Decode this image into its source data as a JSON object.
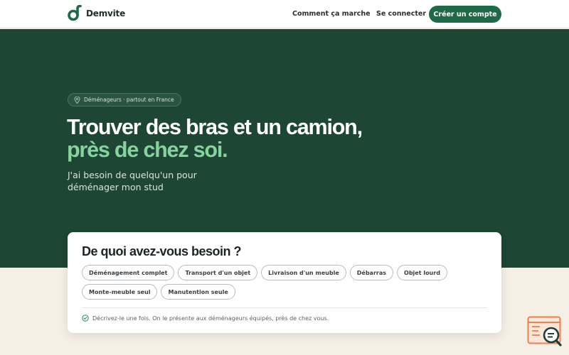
{
  "header": {
    "brand": "Demvite",
    "logo_icon": "demvite-logo-icon",
    "nav": {
      "how_it_works": "Comment ça marche",
      "login": "Se connecter",
      "signup": "Créer un compte"
    }
  },
  "hero": {
    "badge": {
      "icon": "map-pin-icon",
      "text": "Déménageurs · partout en France"
    },
    "title_line1": "Trouver des bras et un camion,",
    "title_line2": "près de chez soi.",
    "subtitle": "J'ai besoin de quelqu'un pour déménager mon stud"
  },
  "card": {
    "title": "De quoi avez-vous besoin ?",
    "chips": [
      "Déménagement complet",
      "Transport d'un objet",
      "Livraison d'un meuble",
      "Débarras",
      "Objet lourd",
      "Monte-meuble seul",
      "Manutention seule"
    ],
    "footnote": {
      "icon": "check-circle-icon",
      "text": "Décrivez-le une fois. On le présente aux déménageurs équipés, près de chez vous."
    }
  },
  "widget": {
    "icon": "chat-search-icon"
  },
  "colors": {
    "hero_bg": "#1e4634",
    "accent_green": "#86d39e",
    "cta_bg": "#1e6a47",
    "page_bg": "#f5efe6",
    "widget_orange": "#e9824c"
  }
}
